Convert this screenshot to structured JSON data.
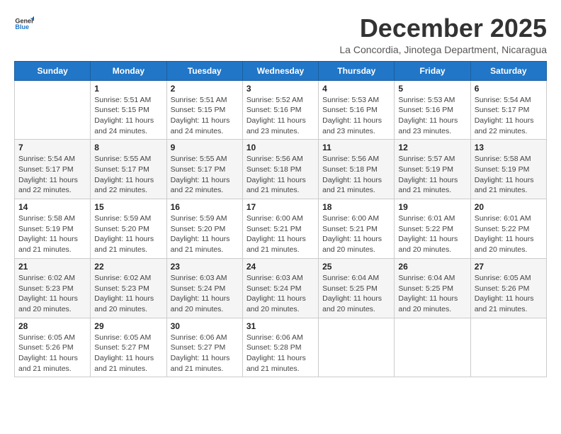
{
  "header": {
    "logo_general": "General",
    "logo_blue": "Blue",
    "month_title": "December 2025",
    "subtitle": "La Concordia, Jinotega Department, Nicaragua"
  },
  "weekdays": [
    "Sunday",
    "Monday",
    "Tuesday",
    "Wednesday",
    "Thursday",
    "Friday",
    "Saturday"
  ],
  "weeks": [
    [
      {
        "day": "",
        "info": ""
      },
      {
        "day": "1",
        "info": "Sunrise: 5:51 AM\nSunset: 5:15 PM\nDaylight: 11 hours\nand 24 minutes."
      },
      {
        "day": "2",
        "info": "Sunrise: 5:51 AM\nSunset: 5:15 PM\nDaylight: 11 hours\nand 24 minutes."
      },
      {
        "day": "3",
        "info": "Sunrise: 5:52 AM\nSunset: 5:16 PM\nDaylight: 11 hours\nand 23 minutes."
      },
      {
        "day": "4",
        "info": "Sunrise: 5:53 AM\nSunset: 5:16 PM\nDaylight: 11 hours\nand 23 minutes."
      },
      {
        "day": "5",
        "info": "Sunrise: 5:53 AM\nSunset: 5:16 PM\nDaylight: 11 hours\nand 23 minutes."
      },
      {
        "day": "6",
        "info": "Sunrise: 5:54 AM\nSunset: 5:17 PM\nDaylight: 11 hours\nand 22 minutes."
      }
    ],
    [
      {
        "day": "7",
        "info": "Sunrise: 5:54 AM\nSunset: 5:17 PM\nDaylight: 11 hours\nand 22 minutes."
      },
      {
        "day": "8",
        "info": "Sunrise: 5:55 AM\nSunset: 5:17 PM\nDaylight: 11 hours\nand 22 minutes."
      },
      {
        "day": "9",
        "info": "Sunrise: 5:55 AM\nSunset: 5:17 PM\nDaylight: 11 hours\nand 22 minutes."
      },
      {
        "day": "10",
        "info": "Sunrise: 5:56 AM\nSunset: 5:18 PM\nDaylight: 11 hours\nand 21 minutes."
      },
      {
        "day": "11",
        "info": "Sunrise: 5:56 AM\nSunset: 5:18 PM\nDaylight: 11 hours\nand 21 minutes."
      },
      {
        "day": "12",
        "info": "Sunrise: 5:57 AM\nSunset: 5:19 PM\nDaylight: 11 hours\nand 21 minutes."
      },
      {
        "day": "13",
        "info": "Sunrise: 5:58 AM\nSunset: 5:19 PM\nDaylight: 11 hours\nand 21 minutes."
      }
    ],
    [
      {
        "day": "14",
        "info": "Sunrise: 5:58 AM\nSunset: 5:19 PM\nDaylight: 11 hours\nand 21 minutes."
      },
      {
        "day": "15",
        "info": "Sunrise: 5:59 AM\nSunset: 5:20 PM\nDaylight: 11 hours\nand 21 minutes."
      },
      {
        "day": "16",
        "info": "Sunrise: 5:59 AM\nSunset: 5:20 PM\nDaylight: 11 hours\nand 21 minutes."
      },
      {
        "day": "17",
        "info": "Sunrise: 6:00 AM\nSunset: 5:21 PM\nDaylight: 11 hours\nand 21 minutes."
      },
      {
        "day": "18",
        "info": "Sunrise: 6:00 AM\nSunset: 5:21 PM\nDaylight: 11 hours\nand 20 minutes."
      },
      {
        "day": "19",
        "info": "Sunrise: 6:01 AM\nSunset: 5:22 PM\nDaylight: 11 hours\nand 20 minutes."
      },
      {
        "day": "20",
        "info": "Sunrise: 6:01 AM\nSunset: 5:22 PM\nDaylight: 11 hours\nand 20 minutes."
      }
    ],
    [
      {
        "day": "21",
        "info": "Sunrise: 6:02 AM\nSunset: 5:23 PM\nDaylight: 11 hours\nand 20 minutes."
      },
      {
        "day": "22",
        "info": "Sunrise: 6:02 AM\nSunset: 5:23 PM\nDaylight: 11 hours\nand 20 minutes."
      },
      {
        "day": "23",
        "info": "Sunrise: 6:03 AM\nSunset: 5:24 PM\nDaylight: 11 hours\nand 20 minutes."
      },
      {
        "day": "24",
        "info": "Sunrise: 6:03 AM\nSunset: 5:24 PM\nDaylight: 11 hours\nand 20 minutes."
      },
      {
        "day": "25",
        "info": "Sunrise: 6:04 AM\nSunset: 5:25 PM\nDaylight: 11 hours\nand 20 minutes."
      },
      {
        "day": "26",
        "info": "Sunrise: 6:04 AM\nSunset: 5:25 PM\nDaylight: 11 hours\nand 20 minutes."
      },
      {
        "day": "27",
        "info": "Sunrise: 6:05 AM\nSunset: 5:26 PM\nDaylight: 11 hours\nand 21 minutes."
      }
    ],
    [
      {
        "day": "28",
        "info": "Sunrise: 6:05 AM\nSunset: 5:26 PM\nDaylight: 11 hours\nand 21 minutes."
      },
      {
        "day": "29",
        "info": "Sunrise: 6:05 AM\nSunset: 5:27 PM\nDaylight: 11 hours\nand 21 minutes."
      },
      {
        "day": "30",
        "info": "Sunrise: 6:06 AM\nSunset: 5:27 PM\nDaylight: 11 hours\nand 21 minutes."
      },
      {
        "day": "31",
        "info": "Sunrise: 6:06 AM\nSunset: 5:28 PM\nDaylight: 11 hours\nand 21 minutes."
      },
      {
        "day": "",
        "info": ""
      },
      {
        "day": "",
        "info": ""
      },
      {
        "day": "",
        "info": ""
      }
    ]
  ]
}
